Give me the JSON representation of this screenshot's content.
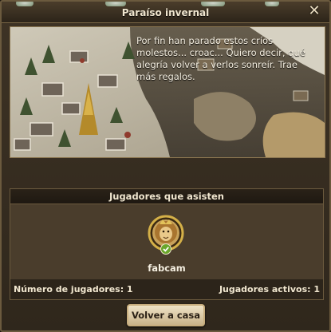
{
  "dialog": {
    "title": "Paraíso invernal",
    "close_icon": "close-icon"
  },
  "scene": {
    "story_text": "Por fin han parado estos críos molestos... croac... Quiero decir, qué alegría volver a verlos sonreír. Trae más regalos."
  },
  "attendance": {
    "header": "Jugadores que asisten",
    "players": [
      {
        "name": "fabcam",
        "avatar_icon": "lion-portrait-icon",
        "status_icon": "check-icon"
      }
    ],
    "player_count_label": "Número de jugadores: 1",
    "active_players_label": "Jugadores activos: 1"
  },
  "actions": {
    "return_label": "Volver a casa"
  },
  "colors": {
    "panel_bg": "#3e3325",
    "border": "#6b5a3e",
    "text": "#f0e6cf",
    "button_bg": "#efe3c6"
  }
}
